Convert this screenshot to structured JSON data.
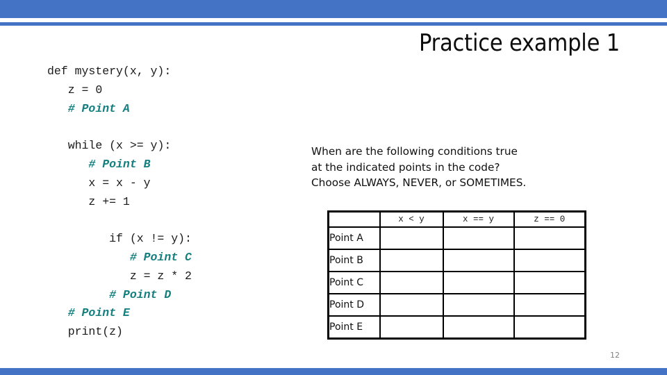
{
  "slide": {
    "title": "Practice example 1",
    "page_number": "12",
    "accent_color": "#4472c4",
    "comment_color": "#157f7f"
  },
  "code": {
    "lines": [
      {
        "text": "def mystery(x, y):",
        "indent": 0,
        "comment": false
      },
      {
        "text": "z = 0",
        "indent": 3,
        "comment": false
      },
      {
        "text": "# Point A",
        "indent": 3,
        "comment": true
      },
      {
        "text": "",
        "indent": 0,
        "comment": false
      },
      {
        "text": "while (x >= y):",
        "indent": 3,
        "comment": false
      },
      {
        "text": "# Point B",
        "indent": 6,
        "comment": true
      },
      {
        "text": "x = x - y",
        "indent": 6,
        "comment": false
      },
      {
        "text": "z += 1",
        "indent": 6,
        "comment": false
      },
      {
        "text": "",
        "indent": 0,
        "comment": false
      },
      {
        "text": "if (x != y):",
        "indent": 9,
        "comment": false
      },
      {
        "text": "# Point C",
        "indent": 12,
        "comment": true
      },
      {
        "text": "z = z * 2",
        "indent": 12,
        "comment": false
      },
      {
        "text": "# Point D",
        "indent": 9,
        "comment": true
      },
      {
        "text": "# Point E",
        "indent": 3,
        "comment": true
      },
      {
        "text": "print(z)",
        "indent": 3,
        "comment": false
      }
    ]
  },
  "prompt": {
    "line1": "When are the following conditions true",
    "line2": "at the indicated points in the code?",
    "line3": "Choose ALWAYS, NEVER, or SOMETIMES."
  },
  "table": {
    "headers": [
      "",
      "x < y",
      "x == y",
      "z == 0"
    ],
    "rows": [
      {
        "label": "Point A",
        "cells": [
          "",
          "",
          ""
        ]
      },
      {
        "label": "Point B",
        "cells": [
          "",
          "",
          ""
        ]
      },
      {
        "label": "Point C",
        "cells": [
          "",
          "",
          ""
        ]
      },
      {
        "label": "Point D",
        "cells": [
          "",
          "",
          ""
        ]
      },
      {
        "label": "Point E",
        "cells": [
          "",
          "",
          ""
        ]
      }
    ]
  }
}
